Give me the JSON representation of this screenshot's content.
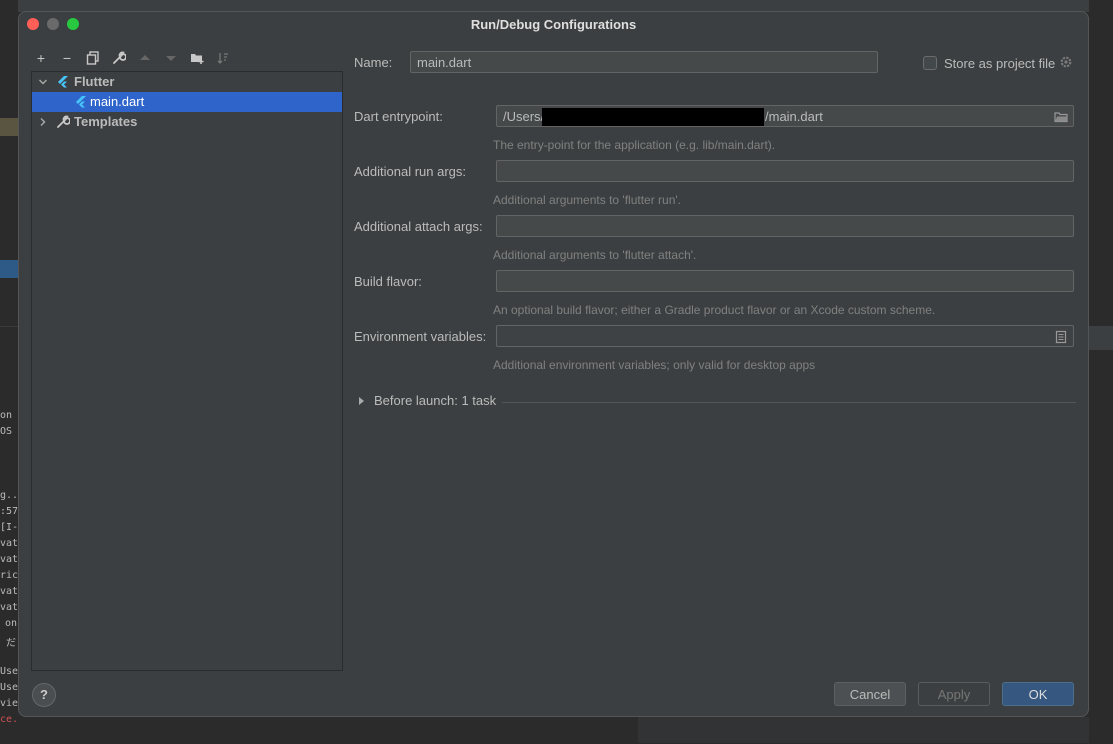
{
  "dialog": {
    "title": "Run/Debug Configurations"
  },
  "toolbar": {
    "add": "+",
    "remove": "−"
  },
  "tree": {
    "flutter_label": "Flutter",
    "main_label": "main.dart",
    "templates_label": "Templates"
  },
  "form": {
    "name_label": "Name:",
    "name_value": "main.dart",
    "store_label": "Store as project file",
    "entry_label": "Dart entrypoint:",
    "entry_prefix": "/Users/",
    "entry_suffix": "/main.dart",
    "entry_hint": "The entry-point for the application (e.g. lib/main.dart).",
    "run_label": "Additional run args:",
    "run_hint": "Additional arguments to 'flutter run'.",
    "attach_label": "Additional attach args:",
    "attach_hint": "Additional arguments to 'flutter attach'.",
    "flavor_label": "Build flavor:",
    "flavor_hint": "An optional build flavor; either a Gradle product flavor or an Xcode custom scheme.",
    "env_label": "Environment variables:",
    "env_hint": "Additional environment variables; only valid for desktop apps",
    "before_launch": "Before launch: 1 task"
  },
  "buttons": {
    "help": "?",
    "cancel": "Cancel",
    "apply": "Apply",
    "ok": "OK"
  },
  "background": {
    "frag_0": "on",
    "frag_1": "OS",
    "frag_2": "g..",
    "frag_3": ":57",
    "frag_4": "[I-",
    "frag_5": "vat",
    "frag_6": "vat",
    "frag_7": "ric",
    "frag_8": "vat",
    "frag_9": "vat",
    "frag_10": "on",
    "frag_11": "だ",
    "frag_12": "Use",
    "frag_13": "Use",
    "frag_14": "vie",
    "frag_15": "ce."
  },
  "colors": {
    "dialog_bg": "#3c3f41",
    "selection": "#2f65ca",
    "flutter_blue": "#47c5fb",
    "ok_button": "#365880"
  }
}
